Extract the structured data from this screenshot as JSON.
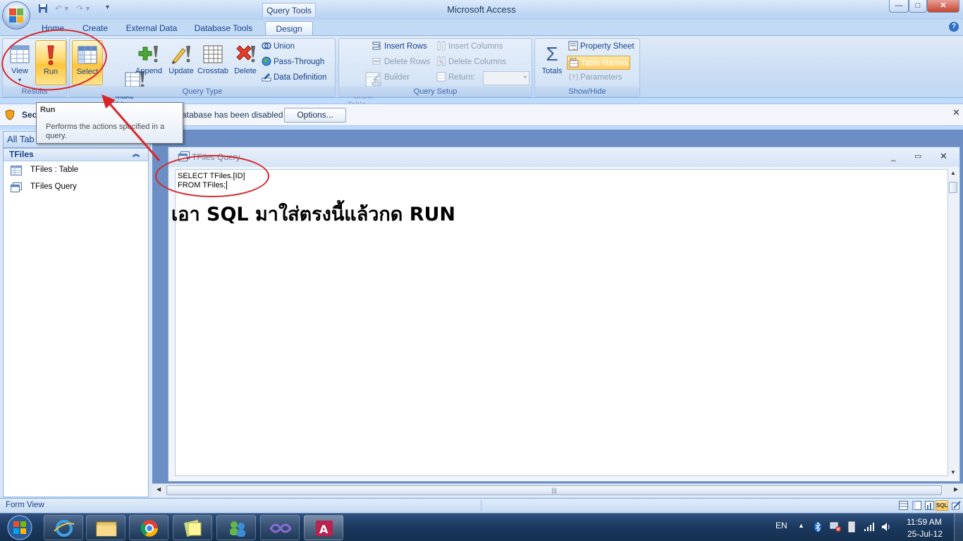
{
  "window": {
    "title": "Microsoft Access",
    "context_tab_label": "Query Tools",
    "controls": {
      "minimize": "—",
      "maximize": "□",
      "close": "✕"
    }
  },
  "tabs": [
    {
      "label": "Home"
    },
    {
      "label": "Create"
    },
    {
      "label": "External Data"
    },
    {
      "label": "Database Tools"
    },
    {
      "label": "Design"
    }
  ],
  "ribbon": {
    "results": {
      "label": "Results",
      "view": "View",
      "run": "Run"
    },
    "query_type": {
      "label": "Query Type",
      "select": "Select",
      "make_table": "Make\nTable",
      "append": "Append",
      "update": "Update",
      "crosstab": "Crosstab",
      "delete": "Delete",
      "union": "Union",
      "pass_through": "Pass-Through",
      "data_definition": "Data Definition"
    },
    "query_setup": {
      "label": "Query Setup",
      "show_table": "Show\nTable",
      "insert_rows": "Insert Rows",
      "delete_rows": "Delete Rows",
      "builder": "Builder",
      "insert_columns": "Insert Columns",
      "delete_columns": "Delete Columns",
      "return": "Return:"
    },
    "show_hide": {
      "label": "Show/Hide",
      "totals": "Totals",
      "property_sheet": "Property Sheet",
      "table_names": "Table Names",
      "parameters": "Parameters"
    }
  },
  "security_bar": {
    "prefix": "Sec",
    "message": "atabase has been disabled",
    "options_button": "Options..."
  },
  "tooltip": {
    "title": "Run",
    "body": "Performs the actions specified in a query."
  },
  "nav": {
    "header": "All Tab",
    "group": "TFiles",
    "items": [
      {
        "label": "TFiles : Table",
        "icon": "table-icon"
      },
      {
        "label": "TFiles Query",
        "icon": "query-icon"
      }
    ]
  },
  "query_window": {
    "title": "TFiles Query",
    "sql_line1": "SELECT TFiles.[ID]",
    "sql_line2": "FROM TFiles;"
  },
  "annotation": {
    "text": "เอา SQL มาใส่ตรงนี้แล้วกด RUN",
    "color": "#d8262b"
  },
  "statusbar": {
    "left": "Form View"
  },
  "taskbar": {
    "language": "EN",
    "time": "11:59 AM",
    "date": "25-Jul-12"
  }
}
